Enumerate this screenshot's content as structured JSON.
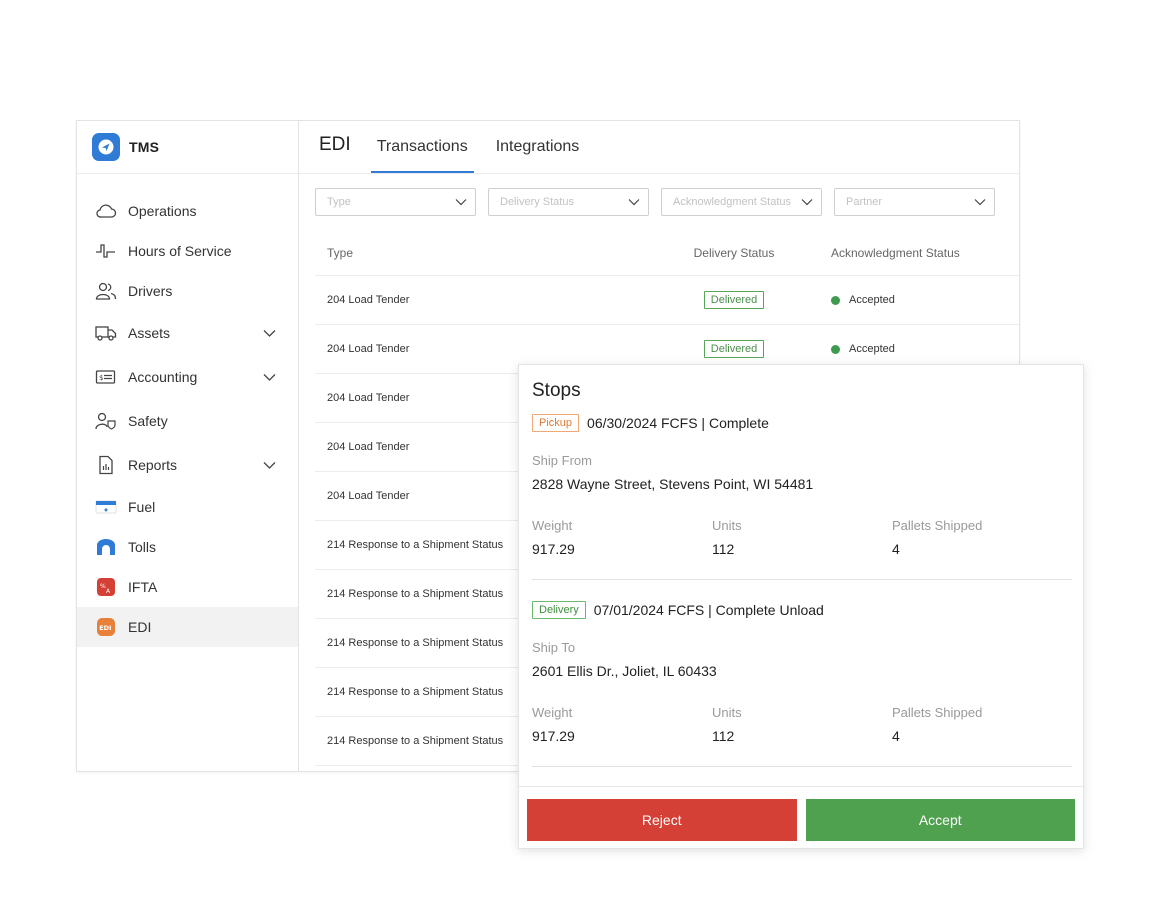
{
  "app": {
    "name": "TMS"
  },
  "sidebar": {
    "items": [
      {
        "label": "Operations",
        "icon": "cloud-icon",
        "expandable": false
      },
      {
        "label": "Hours of Service",
        "icon": "pulse-icon",
        "expandable": false
      },
      {
        "label": "Drivers",
        "icon": "users-icon",
        "expandable": false
      },
      {
        "label": "Assets",
        "icon": "truck-icon",
        "expandable": true
      },
      {
        "label": "Accounting",
        "icon": "billing-icon",
        "expandable": true
      },
      {
        "label": "Safety",
        "icon": "safety-icon",
        "expandable": false
      },
      {
        "label": "Reports",
        "icon": "report-icon",
        "expandable": true
      },
      {
        "label": "Fuel",
        "icon": "fuel-card-icon",
        "expandable": false
      },
      {
        "label": "Tolls",
        "icon": "tolls-icon",
        "expandable": false
      },
      {
        "label": "IFTA",
        "icon": "ifta-icon",
        "expandable": false
      },
      {
        "label": "EDI",
        "icon": "edi-icon",
        "expandable": false,
        "active": true
      }
    ]
  },
  "header": {
    "title": "EDI",
    "tabs": [
      {
        "label": "Transactions",
        "active": true
      },
      {
        "label": "Integrations",
        "active": false
      }
    ]
  },
  "filters": [
    {
      "placeholder": "Type"
    },
    {
      "placeholder": "Delivery Status"
    },
    {
      "placeholder": "Acknowledgment Status"
    },
    {
      "placeholder": "Partner"
    }
  ],
  "table": {
    "columns": [
      "Type",
      "Delivery Status",
      "Acknowledgment Status"
    ],
    "rows": [
      {
        "type": "204 Load Tender",
        "delivery": "Delivered",
        "ack": "Accepted"
      },
      {
        "type": "204 Load Tender",
        "delivery": "Delivered",
        "ack": "Accepted"
      },
      {
        "type": "204 Load Tender",
        "delivery": "",
        "ack": ""
      },
      {
        "type": "204 Load Tender",
        "delivery": "",
        "ack": ""
      },
      {
        "type": "204 Load Tender",
        "delivery": "",
        "ack": ""
      },
      {
        "type": "214 Response to a Shipment Status",
        "delivery": "",
        "ack": ""
      },
      {
        "type": "214 Response to a Shipment Status",
        "delivery": "",
        "ack": ""
      },
      {
        "type": "214 Response to a Shipment Status",
        "delivery": "",
        "ack": ""
      },
      {
        "type": "214 Response to a Shipment Status",
        "delivery": "",
        "ack": ""
      },
      {
        "type": "214 Response to a Shipment Status",
        "delivery": "",
        "ack": ""
      }
    ]
  },
  "stops": {
    "title": "Stops",
    "pickup": {
      "tag": "Pickup",
      "summary": "06/30/2024 FCFS | Complete",
      "address_label": "Ship From",
      "address": "2828 Wayne Street, Stevens Point, WI 54481",
      "weight_label": "Weight",
      "weight": "917.29",
      "units_label": "Units",
      "units": "112",
      "pallets_label": "Pallets Shipped",
      "pallets": "4"
    },
    "delivery": {
      "tag": "Delivery",
      "summary": "07/01/2024 FCFS | Complete Unload",
      "address_label": "Ship To",
      "address": "2601 Ellis Dr., Joliet, IL 60433",
      "weight_label": "Weight",
      "weight": "917.29",
      "units_label": "Units",
      "units": "112",
      "pallets_label": "Pallets Shipped",
      "pallets": "4"
    },
    "reject_label": "Reject",
    "accept_label": "Accept"
  },
  "colors": {
    "brand": "#2f7bd6",
    "reject": "#d44036",
    "accept": "#4fa04f",
    "accepted_dot": "#3e9b4d"
  }
}
